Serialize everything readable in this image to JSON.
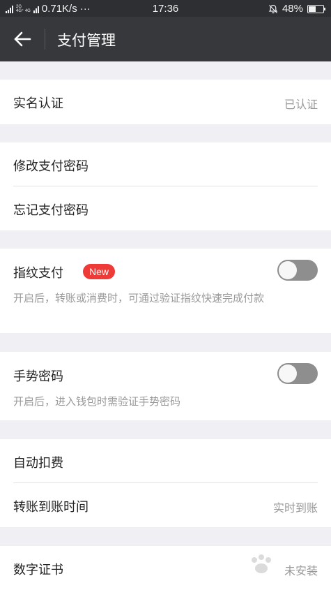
{
  "status_bar": {
    "network_top": "2G",
    "network_mid": "4G⁺ 4G",
    "speed": "0.71K/s",
    "more": "···",
    "time": "17:36",
    "battery": "48%",
    "battery_level": 0.48
  },
  "header": {
    "title": "支付管理",
    "back_icon": "arrow-left-icon"
  },
  "settings": {
    "real_name": {
      "label": "实名认证",
      "value": "已认证"
    },
    "change_password": {
      "label": "修改支付密码"
    },
    "forgot_password": {
      "label": "忘记支付密码"
    },
    "fingerprint": {
      "label": "指纹支付",
      "badge": "New",
      "enabled": false,
      "description": "开启后，转账或消费时，可通过验证指纹快速完成付款"
    },
    "gesture": {
      "label": "手势密码",
      "enabled": false,
      "description": "开启后，进入钱包时需验证手势密码"
    },
    "auto_deduct": {
      "label": "自动扣费"
    },
    "transfer_time": {
      "label": "转账到账时间",
      "value": "实时到账"
    },
    "certificate": {
      "label": "数字证书",
      "value": "未安装"
    }
  },
  "colors": {
    "header_bg": "#36383c",
    "badge": "#ef3b38",
    "toggle_off": "#8e8e8e",
    "page_bg": "#efeff4"
  }
}
